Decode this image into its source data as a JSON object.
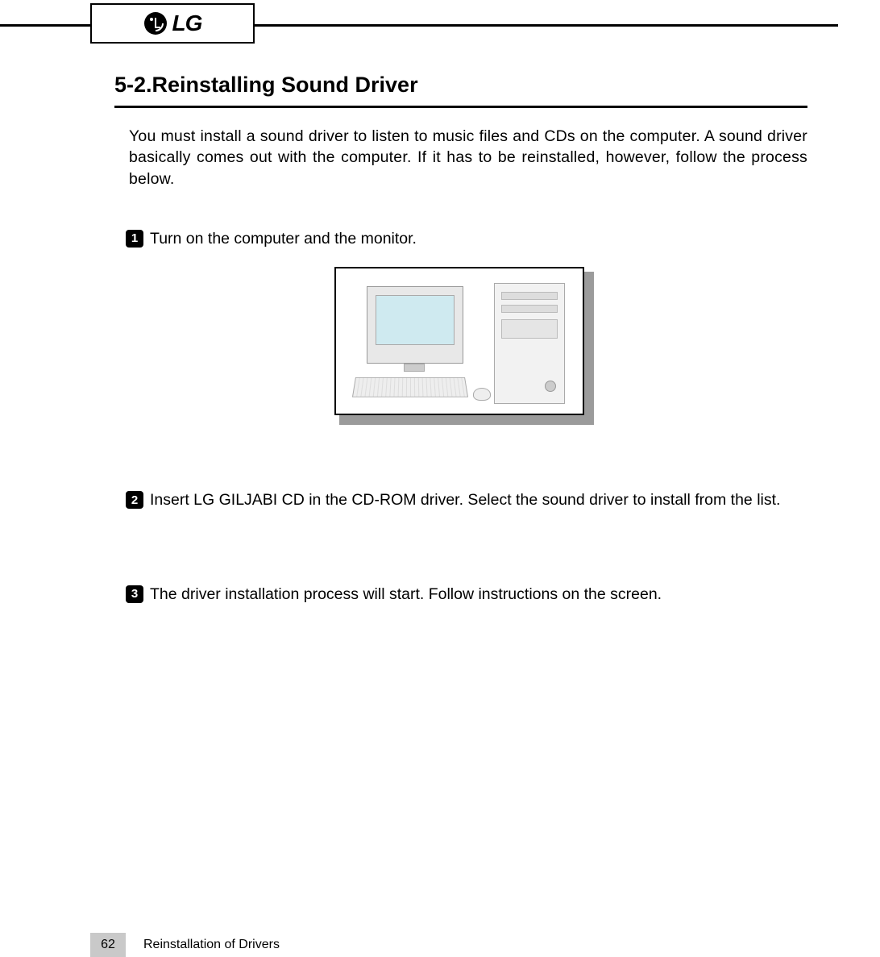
{
  "header": {
    "logo_text": "LG"
  },
  "section": {
    "title": "5-2.Reinstalling Sound Driver",
    "intro": "You must install a sound driver to listen to music files and CDs on the computer. A sound driver basically comes out with the computer. If it has to be reinstalled, however, follow the process below."
  },
  "steps": [
    {
      "num": "1",
      "text": "Turn on the computer and the monitor."
    },
    {
      "num": "2",
      "text": "Insert LG GILJABI CD in the CD-ROM driver. Select the sound driver to install from the list."
    },
    {
      "num": "3",
      "text": "The driver installation process will start. Follow instructions on the screen."
    }
  ],
  "footer": {
    "page_number": "62",
    "chapter": "Reinstallation of Drivers"
  }
}
